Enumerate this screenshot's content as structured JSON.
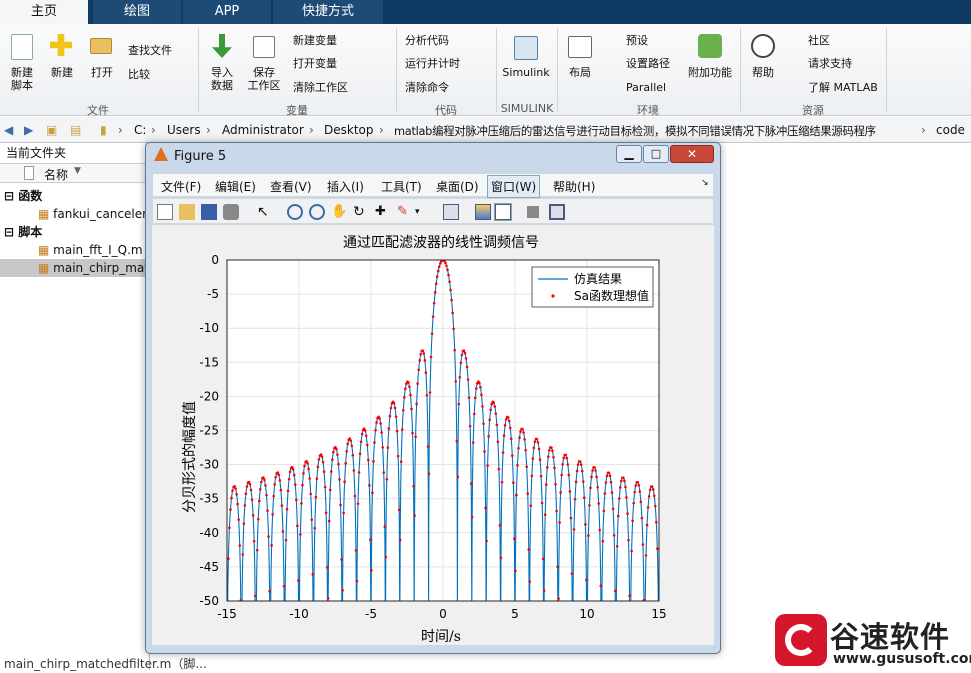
{
  "tabs": {
    "home": "主页",
    "plots": "绘图",
    "apps": "APP",
    "shortcuts": "快捷方式"
  },
  "ribbon": {
    "new_script": "新建\n脚本",
    "new": "新建",
    "open": "打开",
    "find_files": "查找文件",
    "compare": "比较",
    "file_group": "文件",
    "import": "导入\n数据",
    "save_ws": "保存\n工作区",
    "new_var": "新建变量",
    "open_var": "打开变量",
    "clear_ws": "清除工作区",
    "variable_group": "变量",
    "analyze": "分析代码",
    "run_time": "运行并计时",
    "clear_cmd": "清除命令",
    "code_group": "代码",
    "simulink": "Simulink",
    "simulink_group": "SIMULINK",
    "layout": "布局",
    "prefs": "预设",
    "set_path": "设置路径",
    "parallel": "Parallel",
    "addons": "附加功能",
    "env_group": "环境",
    "help": "帮助",
    "community": "社区",
    "request_support": "请求支持",
    "learn": "了解 MATLAB",
    "resources_group": "资源"
  },
  "address": {
    "drive": "C:",
    "p1": "Users",
    "p2": "Administrator",
    "p3": "Desktop",
    "p4": "matlab编程对脉冲压缩后的雷达信号进行动目标检测，模拟不同错误情况下脉冲压缩结果源码程序",
    "p5": "code"
  },
  "left": {
    "title": "当前文件夹",
    "col": "名称",
    "func_group": "函数",
    "func1": "fankui_canceler",
    "script_group": "脚本",
    "s1": "main_fft_I_Q.m",
    "s2": "main_chirp_mat",
    "footer": "main_chirp_matchedfilter.m（脚..."
  },
  "figure": {
    "title": "Figure 5",
    "menus": [
      "文件(F)",
      "编辑(E)",
      "查看(V)",
      "插入(I)",
      "工具(T)",
      "桌面(D)",
      "窗口(W)",
      "帮助(H)"
    ]
  },
  "chart_data": {
    "type": "line",
    "title": "通过匹配滤波器的线性调频信号",
    "xlabel": "时间/s",
    "ylabel": "分贝形式的幅度值",
    "xlim": [
      -15,
      15
    ],
    "ylim": [
      -50,
      0
    ],
    "xticks": [
      -15,
      -10,
      -5,
      0,
      5,
      10,
      15
    ],
    "yticks": [
      0,
      -5,
      -10,
      -15,
      -20,
      -25,
      -30,
      -35,
      -40,
      -45,
      -50
    ],
    "grid": true,
    "legend_position": "top-right",
    "series": [
      {
        "name": "仿真结果",
        "style": "solid line",
        "color": "#0072bd",
        "function": "20*log10(|sinc(t)|)"
      },
      {
        "name": "Sa函数理想值",
        "style": "dots",
        "color": "#ff0000",
        "function": "20*log10(|sinc(t)|)"
      }
    ]
  },
  "watermark": {
    "brand": "谷速软件",
    "url": "www.gususoft.com"
  },
  "colors": {
    "titlebar": "#0f3a63",
    "line": "#0072bd",
    "dots": "#ff0000",
    "brand": "#d3162a"
  }
}
